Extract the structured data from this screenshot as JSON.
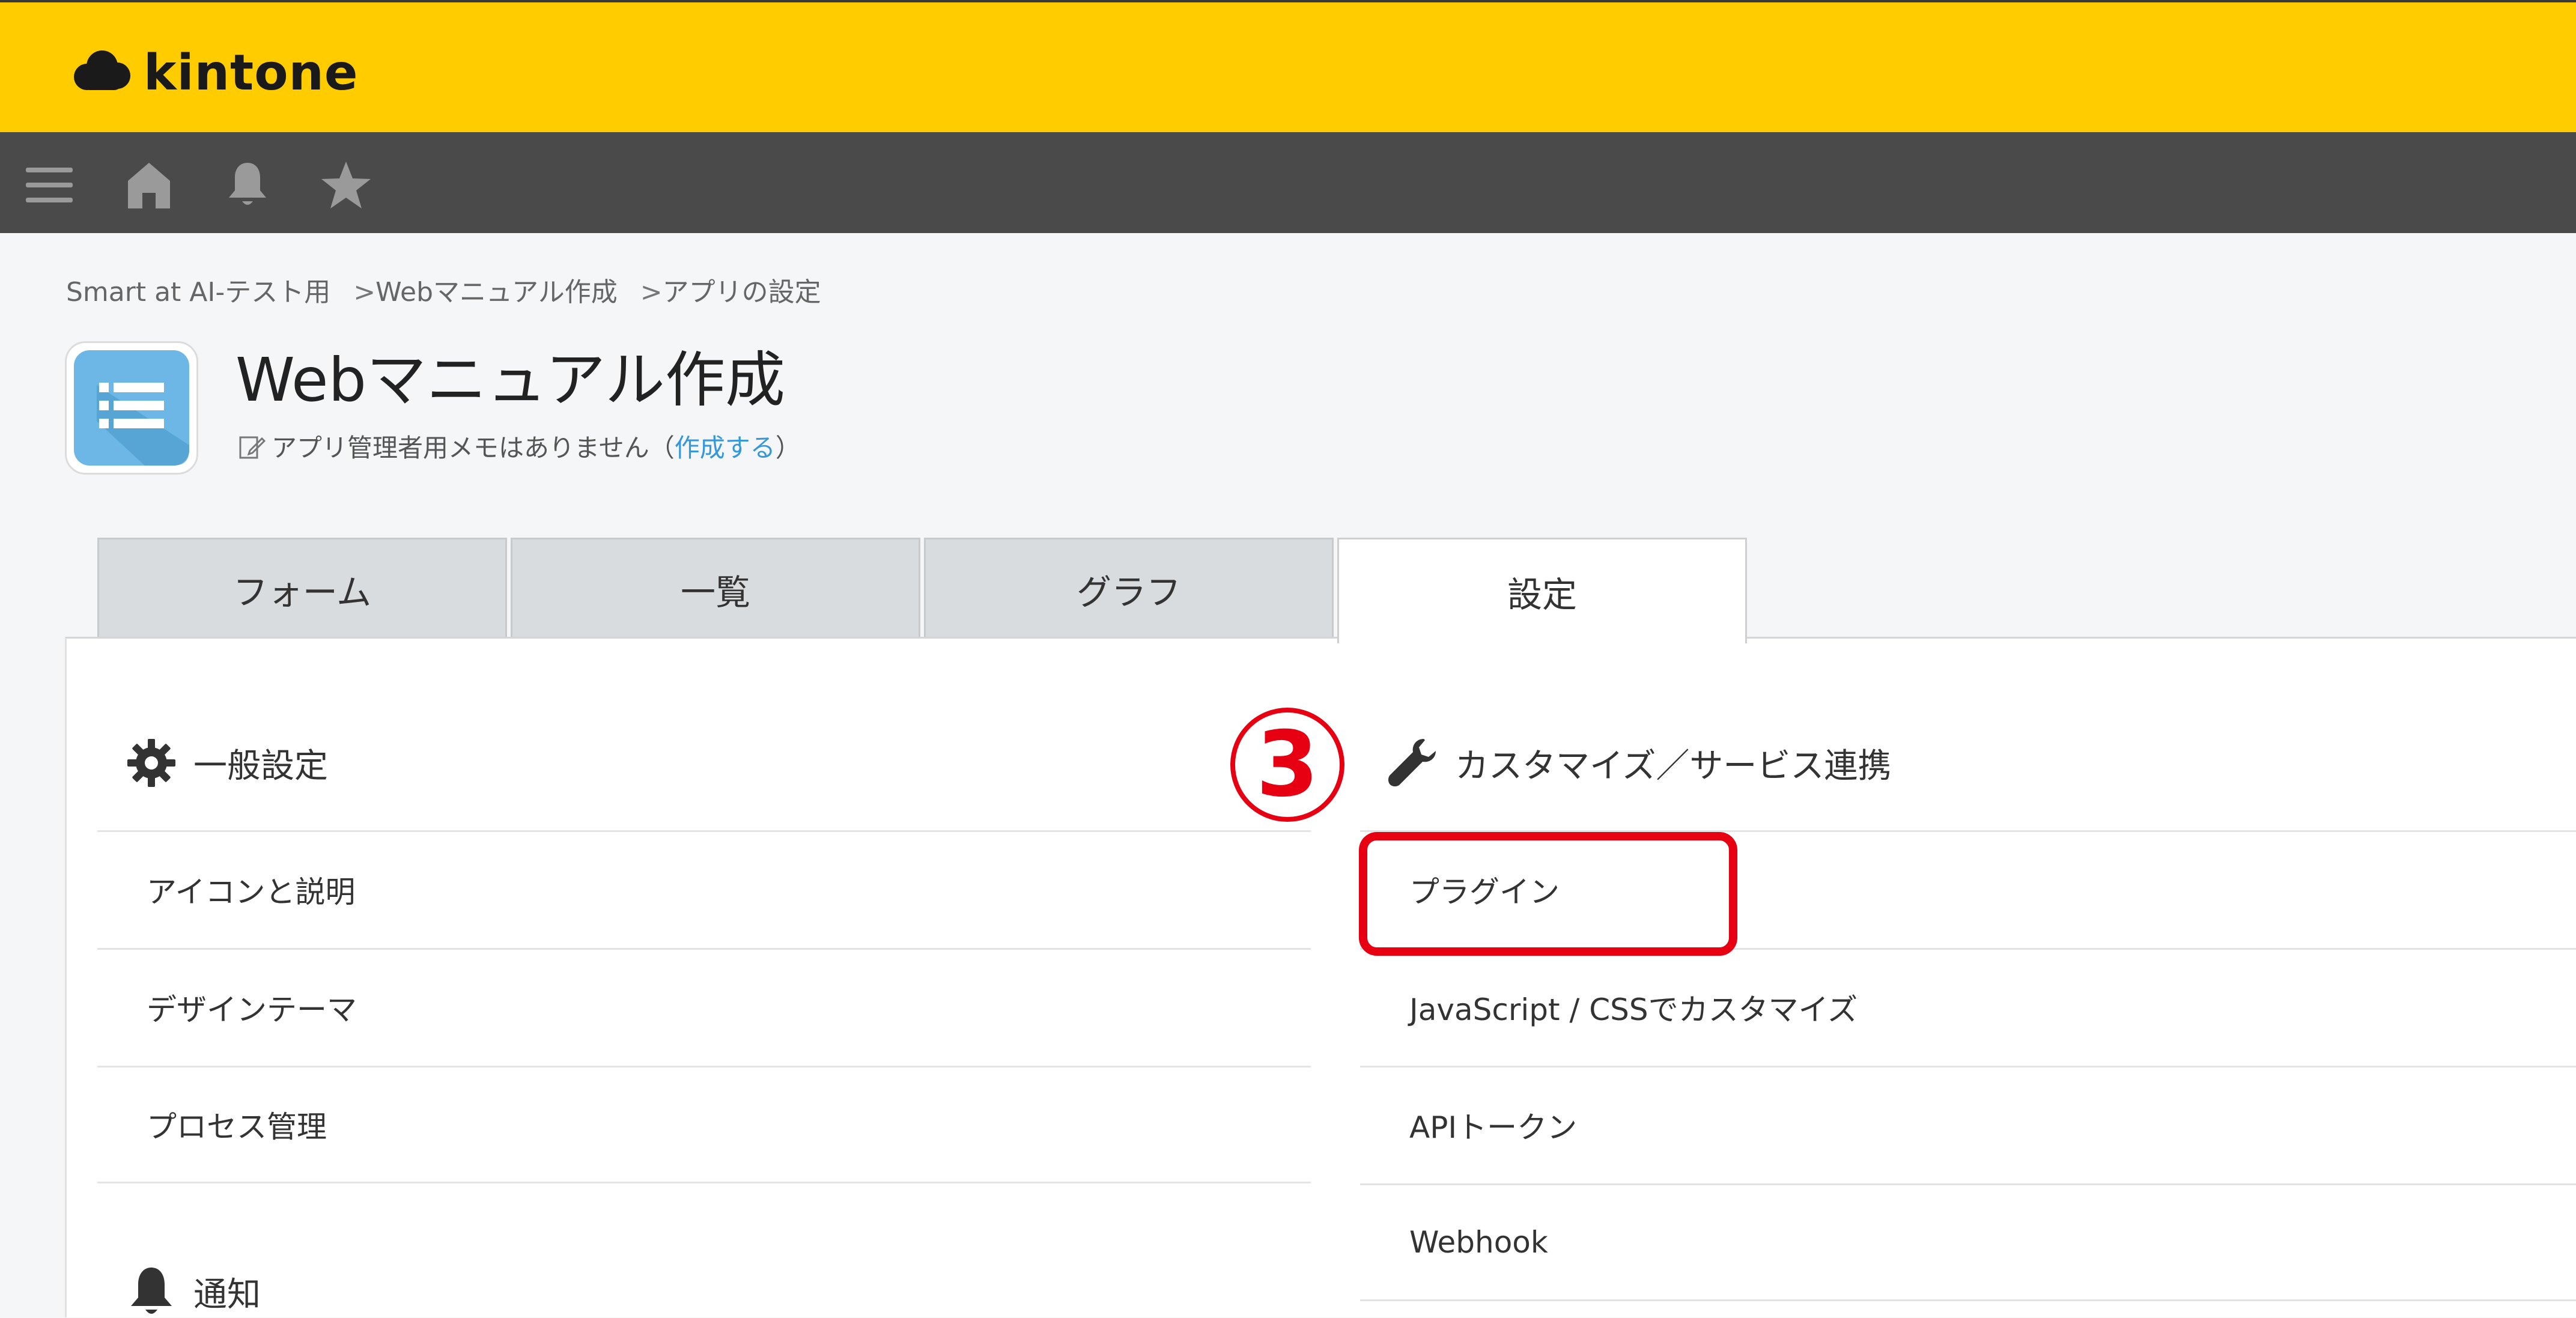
{
  "header": {
    "logo_text": "kintone",
    "bg_color": "#ffcc00"
  },
  "navbar": {
    "icons": [
      "menu-icon",
      "home-icon",
      "bell-icon",
      "star-icon"
    ]
  },
  "breadcrumb": {
    "items": [
      "Smart at AI-テスト用",
      "Webマニュアル作成",
      "アプリの設定"
    ],
    "separator": ">"
  },
  "app": {
    "title": "Webマニュアル作成",
    "memo_text": "アプリ管理者用メモはありません（",
    "memo_link": "作成する",
    "memo_close": "）"
  },
  "tabs": [
    {
      "label": "フォーム",
      "active": false
    },
    {
      "label": "一覧",
      "active": false
    },
    {
      "label": "グラフ",
      "active": false
    },
    {
      "label": "設定",
      "active": true
    }
  ],
  "general": {
    "title": "一般設定",
    "items": [
      "アイコンと説明",
      "デザインテーマ",
      "プロセス管理"
    ]
  },
  "notification": {
    "title": "通知"
  },
  "customize": {
    "title": "カスタマイズ／サービス連携",
    "items": [
      "プラグイン",
      "JavaScript / CSSでカスタマイズ",
      "APIトークン",
      "Webhook"
    ]
  },
  "annotation": {
    "step": "3",
    "color": "#e60012"
  }
}
